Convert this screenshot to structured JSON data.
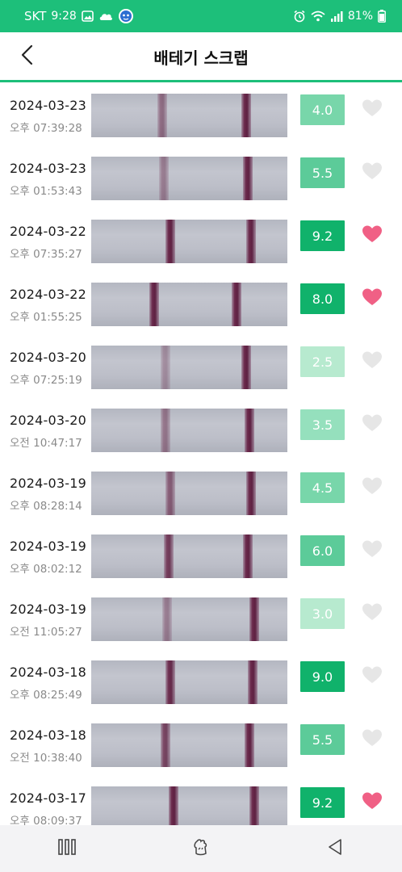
{
  "status_bar": {
    "carrier": "SKT",
    "time": "9:28",
    "battery": "81%",
    "left_icons": [
      "image-icon",
      "cloud-icon",
      "app-badge-icon"
    ],
    "right_icons": [
      "alarm-icon",
      "wifi-icon",
      "signal-icon",
      "battery-icon"
    ]
  },
  "header": {
    "title": "배테기 스크랩",
    "back_icon": "chevron-left-icon"
  },
  "theme": {
    "primary": "#1dbf7a",
    "heart_active": "#f06085",
    "heart_inactive": "#e6e6e6",
    "score_colors": [
      "#b7eacf",
      "#95e0bd",
      "#78d6aa",
      "#5ccb99",
      "#10b26b"
    ]
  },
  "records": [
    {
      "date": "2024-03-23",
      "time": "오후 07:39:28",
      "score": "4.0",
      "score_level": 2,
      "liked": false
    },
    {
      "date": "2024-03-23",
      "time": "오후 01:53:43",
      "score": "5.5",
      "score_level": 3,
      "liked": false
    },
    {
      "date": "2024-03-22",
      "time": "오후 07:35:27",
      "score": "9.2",
      "score_level": 4,
      "liked": true
    },
    {
      "date": "2024-03-22",
      "time": "오후 01:55:25",
      "score": "8.0",
      "score_level": 4,
      "liked": true
    },
    {
      "date": "2024-03-20",
      "time": "오후 07:25:19",
      "score": "2.5",
      "score_level": 0,
      "liked": false
    },
    {
      "date": "2024-03-20",
      "time": "오전 10:47:17",
      "score": "3.5",
      "score_level": 1,
      "liked": false
    },
    {
      "date": "2024-03-19",
      "time": "오후 08:28:14",
      "score": "4.5",
      "score_level": 2,
      "liked": false
    },
    {
      "date": "2024-03-19",
      "time": "오후 08:02:12",
      "score": "6.0",
      "score_level": 3,
      "liked": false
    },
    {
      "date": "2024-03-19",
      "time": "오전 11:05:27",
      "score": "3.0",
      "score_level": 0,
      "liked": false
    },
    {
      "date": "2024-03-18",
      "time": "오후 08:25:49",
      "score": "9.0",
      "score_level": 4,
      "liked": false
    },
    {
      "date": "2024-03-18",
      "time": "오전 10:38:40",
      "score": "5.5",
      "score_level": 3,
      "liked": false
    },
    {
      "date": "2024-03-17",
      "time": "오후 08:09:37",
      "score": "9.2",
      "score_level": 4,
      "liked": true
    }
  ],
  "nav_bar": {
    "icons": [
      "recent-apps-icon",
      "home-icon",
      "back-icon"
    ]
  }
}
